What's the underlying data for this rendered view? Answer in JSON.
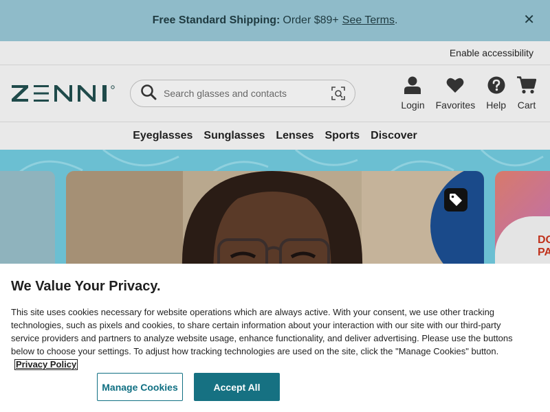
{
  "promo": {
    "bold": "Free Standard Shipping:",
    "text": "Order $89+",
    "link": "See Terms",
    "trail": ".",
    "close": "✕"
  },
  "accessibility": {
    "label": "Enable accessibility"
  },
  "logo": {
    "text": "ZENNI"
  },
  "search": {
    "placeholder": "Search glasses and contacts"
  },
  "nav_icons": [
    {
      "label": "Login",
      "icon": "user-icon"
    },
    {
      "label": "Favorites",
      "icon": "heart-icon"
    },
    {
      "label": "Help",
      "icon": "help-icon"
    },
    {
      "label": "Cart",
      "icon": "cart-icon"
    }
  ],
  "menu": [
    "Eyeglasses",
    "Sunglasses",
    "Lenses",
    "Sports",
    "Discover"
  ],
  "hero": {
    "right_card_text": "DO\nPA"
  },
  "privacy": {
    "title": "We Value Your Privacy.",
    "body": "This site uses cookies necessary for website operations which are always active. With your consent, we use other tracking technologies, such as pixels and cookies, to share certain information about your interaction with our site with our third-party service providers and partners to analyze website usage, enhance functionality, and deliver advertising. Please use the buttons below to choose your settings. To adjust how tracking technologies are used on the site, click the \"Manage Cookies\" button.",
    "policy_link": "Privacy Policy",
    "manage_label": "Manage Cookies",
    "accept_label": "Accept All"
  },
  "colors": {
    "promo_bg": "#8fbbc9",
    "brand_teal": "#167182",
    "hero_bg": "#6bbfd2"
  }
}
